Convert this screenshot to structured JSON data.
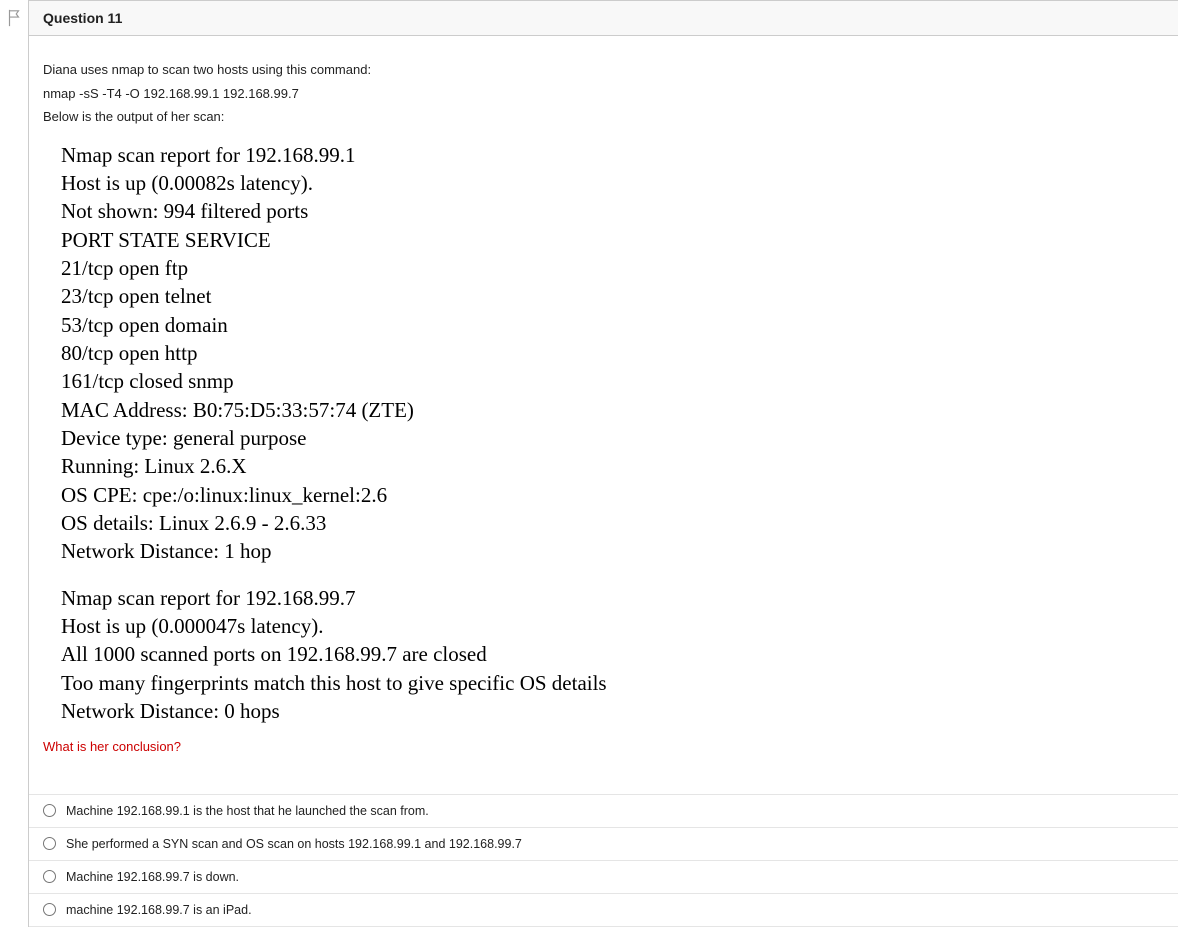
{
  "header": {
    "title": "Question 11"
  },
  "intro": {
    "line1": "Diana uses nmap to scan two hosts using this command:",
    "command": "nmap -sS -T4 -O 192.168.99.1 192.168.99.7",
    "line2": "Below is the output of her scan:"
  },
  "report": {
    "host1": {
      "l1": "Nmap scan report for 192.168.99.1",
      "l2": "Host is up (0.00082s latency).",
      "l3": "Not shown: 994 filtered ports",
      "l4": "PORT STATE SERVICE",
      "l5": "21/tcp open ftp",
      "l6": "23/tcp open telnet",
      "l7": "53/tcp open domain",
      "l8": "80/tcp open http",
      "l9": "161/tcp closed snmp",
      "l10": "MAC Address: B0:75:D5:33:57:74 (ZTE)",
      "l11": "Device type: general purpose",
      "l12": "Running: Linux 2.6.X",
      "l13": "OS CPE: cpe:/o:linux:linux_kernel:2.6",
      "l14": "OS details: Linux 2.6.9 - 2.6.33",
      "l15": "Network Distance: 1 hop"
    },
    "host2": {
      "l1": "Nmap scan report for 192.168.99.7",
      "l2": "Host is up (0.000047s latency).",
      "l3": "All 1000 scanned ports on 192.168.99.7 are closed",
      "l4": "Too many fingerprints match this host to give specific OS details",
      "l5": "Network Distance: 0 hops"
    }
  },
  "prompt": "What is her conclusion?",
  "answers": {
    "a": "Machine 192.168.99.1 is the host that he launched the scan from.",
    "b": "She performed a SYN scan and OS scan on hosts 192.168.99.1 and 192.168.99.7",
    "c": "Machine 192.168.99.7 is down.",
    "d": "machine 192.168.99.7 is an iPad."
  }
}
